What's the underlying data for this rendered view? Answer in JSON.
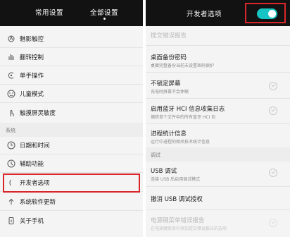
{
  "left": {
    "tabs": [
      "常用设置",
      "全部设置"
    ],
    "items": [
      {
        "label": "魅影触控",
        "icon": "touch-icon"
      },
      {
        "label": "翻转控制",
        "icon": "gesture-icon"
      },
      {
        "label": "单手操作",
        "icon": "one-hand-icon"
      },
      {
        "label": "儿童模式",
        "icon": "child-mode-icon"
      },
      {
        "label": "触摸屏灵敏度",
        "icon": "touch-sensitivity-icon"
      }
    ],
    "section": "系统",
    "system_items": [
      {
        "label": "日期和时间",
        "icon": "clock-icon"
      },
      {
        "label": "辅助功能",
        "icon": "accessibility-icon"
      },
      {
        "label": "开发者选项",
        "icon": "developer-icon"
      },
      {
        "label": "系统软件更新",
        "icon": "arrow-up-icon"
      },
      {
        "label": "关于手机",
        "icon": "info-icon"
      }
    ]
  },
  "right": {
    "title": "开发者选项",
    "toggle_on": true,
    "accent": "#16c5c3",
    "items": [
      {
        "title": "提交错误报告",
        "sub": "",
        "dim": true
      },
      {
        "title": "桌面备份密码",
        "sub": "桌面完整备份当前未设置密码保护"
      },
      {
        "title": "不锁定屏幕",
        "sub": "充电时屏幕不会休眠"
      },
      {
        "title": "启用蓝牙 HCI 信息收集日志",
        "sub": "捕获单个文件中的所有蓝牙 HCI 包"
      },
      {
        "title": "进程统计信息",
        "sub": "运行中进程的相关技术统计信息"
      },
      {
        "title": "USB 调试",
        "sub": "连接 USB 后启用调试模式"
      },
      {
        "title": "撤消 USB 调试授权",
        "sub": ""
      },
      {
        "title": "电源键菜单错误报告",
        "sub": "在电源键菜单中添加提交错误报告的选项",
        "dim": true
      }
    ],
    "section": "调试"
  },
  "highlight_color": "#d8262a"
}
